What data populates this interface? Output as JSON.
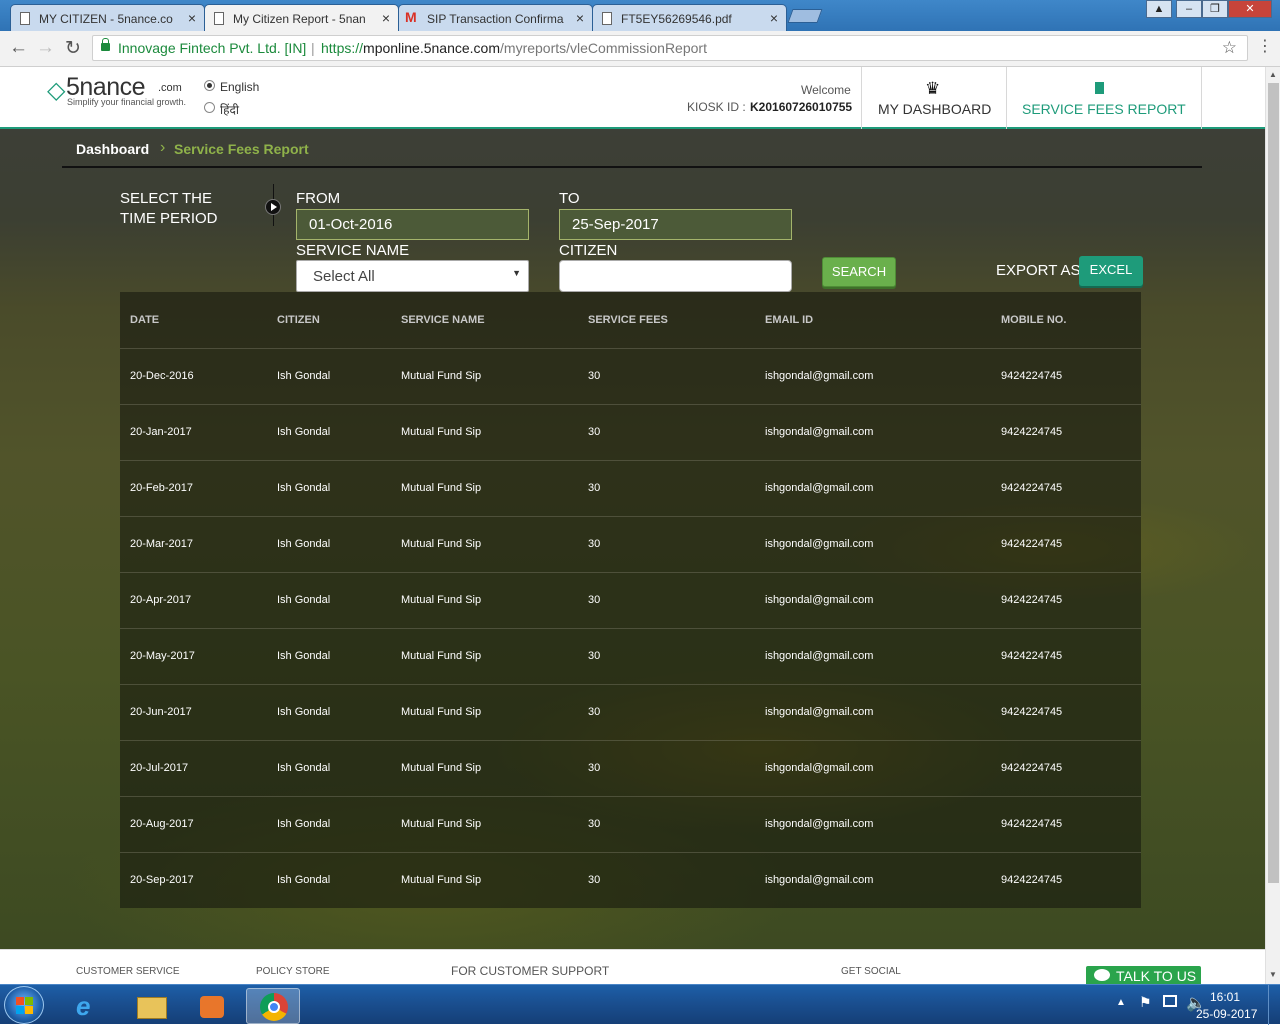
{
  "browser": {
    "tabs": [
      {
        "title": "MY CITIZEN - 5nance.co",
        "active": false
      },
      {
        "title": "My Citizen Report - 5nan",
        "active": true
      },
      {
        "title": "SIP Transaction Confirma",
        "active": false
      },
      {
        "title": "FT5EY56269546.pdf",
        "active": false
      }
    ],
    "address": {
      "org": "Innovage Fintech Pvt. Ltd. [IN]",
      "separator": "|",
      "url_scheme": "https://",
      "url_host": "mponline.5nance.com",
      "url_path": "/myreports/vleCommissionReport"
    }
  },
  "header": {
    "logo": {
      "mark": "◇",
      "name": "5nance",
      "suffix": ".com",
      "tagline": "Simplify your financial growth."
    },
    "languages": [
      {
        "label": "English",
        "selected": true
      },
      {
        "label": "हिंदी",
        "selected": false
      }
    ],
    "welcome": "Welcome",
    "kiosk_label": "KIOSK ID : ",
    "kiosk_id": "K20160726010755",
    "nav": {
      "dashboard": "MY DASHBOARD",
      "service_fees_report": "SERVICE FEES REPORT"
    }
  },
  "breadcrumb": {
    "home": "Dashboard",
    "separator": "›",
    "current": "Service Fees Report"
  },
  "filters": {
    "period_label_1": "SELECT THE",
    "period_label_2": "TIME PERIOD",
    "from_label": "FROM",
    "from_value": "01-Oct-2016",
    "to_label": "TO",
    "to_value": "25-Sep-2017",
    "service_label": "SERVICE NAME",
    "service_value": "Select All",
    "citizen_label": "CITIZEN",
    "citizen_value": "",
    "search_button": "SEARCH",
    "export_label": "EXPORT AS",
    "excel_button": "EXCEL"
  },
  "table": {
    "headers": [
      "DATE",
      "CITIZEN",
      "SERVICE NAME",
      "SERVICE FEES",
      "EMAIL ID",
      "MOBILE NO."
    ],
    "rows": [
      [
        "20-Dec-2016",
        "Ish Gondal",
        "Mutual Fund Sip",
        "30",
        "ishgondal@gmail.com",
        "9424224745"
      ],
      [
        "20-Jan-2017",
        "Ish Gondal",
        "Mutual Fund Sip",
        "30",
        "ishgondal@gmail.com",
        "9424224745"
      ],
      [
        "20-Feb-2017",
        "Ish Gondal",
        "Mutual Fund Sip",
        "30",
        "ishgondal@gmail.com",
        "9424224745"
      ],
      [
        "20-Mar-2017",
        "Ish Gondal",
        "Mutual Fund Sip",
        "30",
        "ishgondal@gmail.com",
        "9424224745"
      ],
      [
        "20-Apr-2017",
        "Ish Gondal",
        "Mutual Fund Sip",
        "30",
        "ishgondal@gmail.com",
        "9424224745"
      ],
      [
        "20-May-2017",
        "Ish Gondal",
        "Mutual Fund Sip",
        "30",
        "ishgondal@gmail.com",
        "9424224745"
      ],
      [
        "20-Jun-2017",
        "Ish Gondal",
        "Mutual Fund Sip",
        "30",
        "ishgondal@gmail.com",
        "9424224745"
      ],
      [
        "20-Jul-2017",
        "Ish Gondal",
        "Mutual Fund Sip",
        "30",
        "ishgondal@gmail.com",
        "9424224745"
      ],
      [
        "20-Aug-2017",
        "Ish Gondal",
        "Mutual Fund Sip",
        "30",
        "ishgondal@gmail.com",
        "9424224745"
      ],
      [
        "20-Sep-2017",
        "Ish Gondal",
        "Mutual Fund Sip",
        "30",
        "ishgondal@gmail.com",
        "9424224745"
      ]
    ]
  },
  "footer": {
    "customer_service": "CUSTOMER SERVICE",
    "policy_store": "POLICY STORE",
    "customer_support": "FOR CUSTOMER SUPPORT",
    "get_social": "GET SOCIAL",
    "talk_to_us": "TALK TO US"
  },
  "taskbar": {
    "time": "16:01",
    "date": "25-09-2017"
  },
  "colors": {
    "brand_green": "#1e9b7a",
    "search_button": "#6ab04c",
    "excel_button": "#1e9b7a",
    "talk_button": "#2aa44c",
    "breadcrumb_current": "#8fb24a"
  }
}
